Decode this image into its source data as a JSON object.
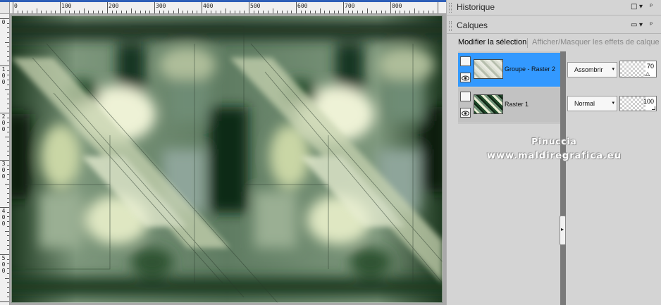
{
  "ruler": {
    "h_labels": [
      "0",
      "100",
      "200",
      "300",
      "400",
      "500",
      "600",
      "700",
      "800"
    ],
    "v_labels": [
      "0",
      "1\n0\n0",
      "2\n0\n0",
      "3\n0\n0",
      "4\n0\n0",
      "5\n0\n0"
    ]
  },
  "panels": {
    "historique": {
      "title": "Historique",
      "icons": [
        "window-icon",
        "pin-icon"
      ]
    },
    "calques": {
      "title": "Calques",
      "icons": [
        "window-icon",
        "pin-icon"
      ]
    }
  },
  "layers_toolbar": {
    "modify_selection": "Modifier la sélection",
    "toggle_effects": "Afficher/Masquer les effets de calque"
  },
  "layers": [
    {
      "name": "Groupe - Raster 2",
      "blend_mode": "Assombrir",
      "opacity": "70",
      "selected": true
    },
    {
      "name": "Raster 1",
      "blend_mode": "Normal",
      "opacity": "100",
      "selected": false
    }
  ],
  "watermark": {
    "line1": "Pinuccia",
    "line2": "www.maldiregrafica.eu"
  },
  "colors": {
    "selection": "#3399ff",
    "title_strip": "#2e5fb8",
    "panel_bg": "#d4d4d4",
    "splitter": "#7a7a7a",
    "link_active": "#000000",
    "link_disabled": "#8a8a8a"
  }
}
